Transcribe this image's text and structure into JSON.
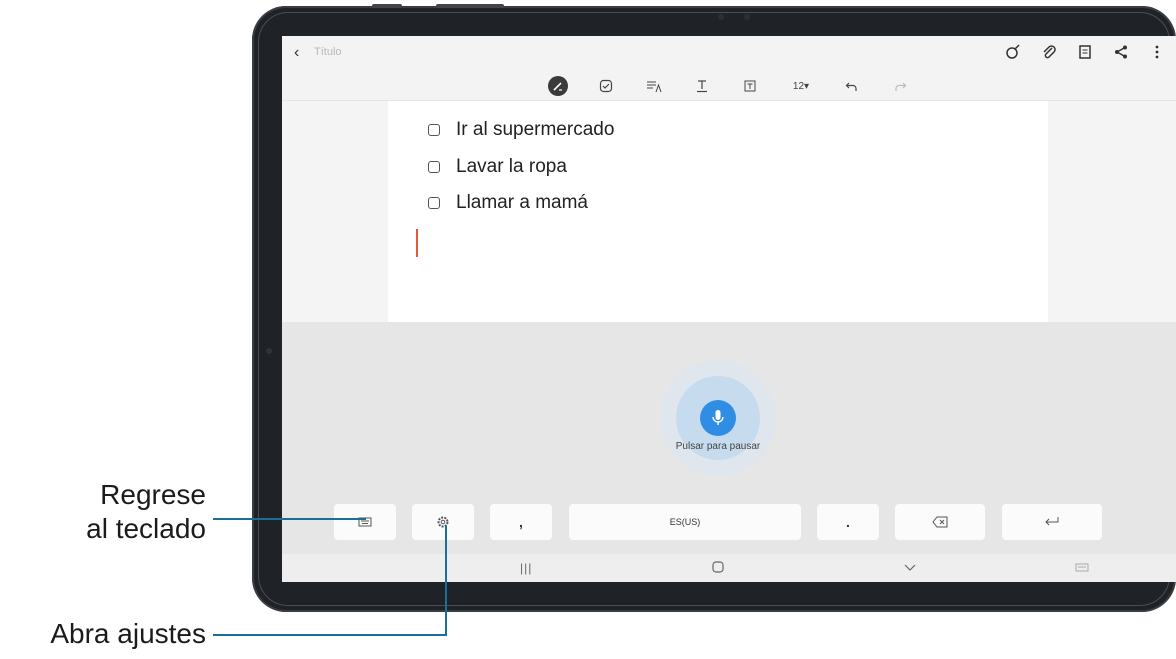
{
  "note": {
    "title_placeholder": "Título",
    "items": [
      {
        "label": "Ir al supermercado"
      },
      {
        "label": "Lavar la ropa"
      },
      {
        "label": "Llamar a mamá"
      }
    ]
  },
  "toolbar": {
    "font_size": "12▾"
  },
  "voice": {
    "status": "Pulsar para pausar"
  },
  "keyboard": {
    "comma": ",",
    "language": "ES(US)",
    "period": "."
  },
  "callouts": {
    "return_keyboard_line1": "Regrese",
    "return_keyboard_line2": "al teclado",
    "open_settings": "Abra ajustes"
  },
  "colors": {
    "mic": "#2f8ee3",
    "cursor": "#e25a3c",
    "callout_line": "#1b6f96"
  }
}
